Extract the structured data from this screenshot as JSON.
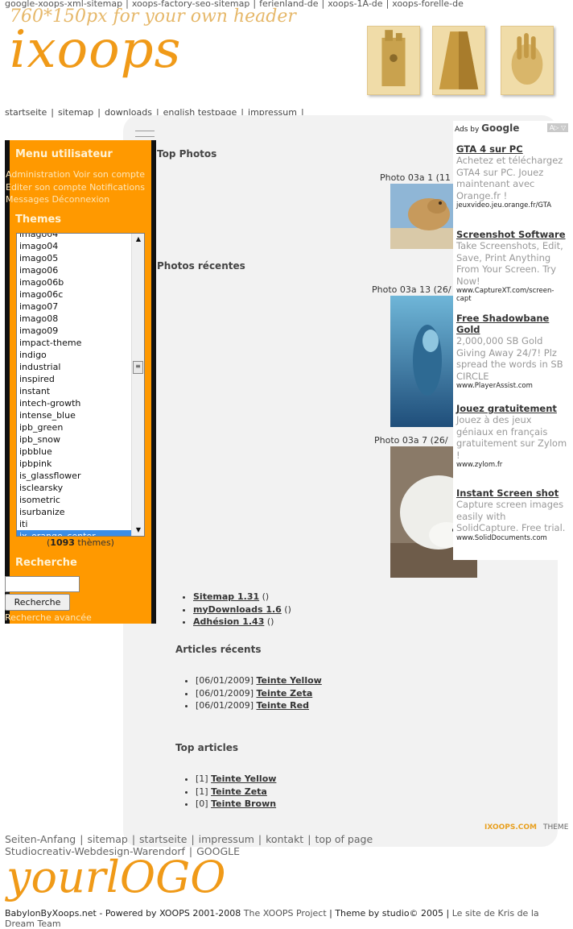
{
  "top_links": [
    "google-xoops-xml-sitemap",
    "xoops-factory-seo-sitemap",
    "ferienland-de",
    "xoops-1A-de",
    "xoops-forelle-de"
  ],
  "header": {
    "tagline": "760*150px for your own header",
    "logo_text": "ixoops"
  },
  "main_nav": [
    "startseite",
    "sitemap",
    "downloads",
    "english testpage",
    "impressum"
  ],
  "user_menu": {
    "title": "Menu utilisateur",
    "links": [
      "Administration",
      "Voir son compte",
      "Editer son compte",
      "Notifications",
      "Messages",
      "Déconnexion"
    ]
  },
  "themes": {
    "title": "Themes",
    "items": [
      "imago04",
      "imago05",
      "imago06",
      "imago06b",
      "imago06c",
      "imago07",
      "imago08",
      "imago09",
      "impact-theme",
      "indigo",
      "industrial",
      "inspired",
      "instant",
      "intech-growth",
      "intense_blue",
      "ipb_green",
      "ipb_snow",
      "ipbblue",
      "ipbpink",
      "is_glassflower",
      "isclearsky",
      "isometric",
      "isurbanize",
      "iti",
      "ix_orange_center"
    ],
    "selected": "ix_orange_center",
    "count_prefix": "(",
    "count": "1093",
    "count_suffix": " thèmes)"
  },
  "search": {
    "title": "Recherche",
    "input_value": "",
    "button_label": "Recherche",
    "advanced_link": "Recherche avancée"
  },
  "top_photos": {
    "title": "Top Photos",
    "caption": "Photo 03a 1 (11"
  },
  "recent_photos": {
    "title": "Photos récentes",
    "captions": [
      "Photo 03a 13 (26/",
      "Photo 03a 7 (26/"
    ]
  },
  "modules": [
    {
      "name": "Sitemap 1.31",
      "suffix": " ()"
    },
    {
      "name": "myDownloads 1.6",
      "suffix": " ()"
    },
    {
      "name": "Adhésion 1.43",
      "suffix": " ()"
    }
  ],
  "recent_articles": {
    "title": "Articles récents",
    "items": [
      {
        "prefix": "[06/01/2009] ",
        "link": "Teinte Yellow"
      },
      {
        "prefix": "[06/01/2009] ",
        "link": "Teinte Zeta"
      },
      {
        "prefix": "[06/01/2009] ",
        "link": "Teinte Red"
      }
    ]
  },
  "top_articles": {
    "title": "Top articles",
    "items": [
      {
        "prefix": "[1] ",
        "link": "Teinte Yellow"
      },
      {
        "prefix": "[1] ",
        "link": "Teinte Zeta"
      },
      {
        "prefix": "[0] ",
        "link": "Teinte Brown"
      }
    ]
  },
  "ads": {
    "header_prefix": "Ads by ",
    "header_brand": "Google",
    "chip": "A▷ ▽",
    "items": [
      {
        "title": "GTA 4 sur PC",
        "desc": "Achetez et téléchargez GTA4 sur PC. Jouez maintenant avec Orange.fr !",
        "url": "jeuxvideo.jeu.orange.fr/GTA"
      },
      {
        "title": "Screenshot Software",
        "desc": "Take Screenshots, Edit, Save, Print Anything From Your Screen. Try Now!",
        "url": "www.CaptureXT.com/screen-capt"
      },
      {
        "title": "Free Shadowbane Gold",
        "desc": "2,000,000 SB Gold Giving Away 24/7! Plz spread the words in SB CIRCLE",
        "url": "www.PlayerAssist.com"
      },
      {
        "title": "Jouez gratuitement",
        "desc": "Jouez à des jeux géniaux en français gratuitement sur Zylom !",
        "url": "www.zylom.fr"
      },
      {
        "title": "Instant Screen shot",
        "desc": "Capture screen images easily with SolidCapture. Free trial.",
        "url": "www.SolidDocuments.com"
      }
    ]
  },
  "theme_badge": {
    "left": "IXOOPS.COM",
    "right": "THEME"
  },
  "footer": {
    "links": [
      "Seiten-Anfang",
      "sitemap",
      "startseite",
      "impressum",
      "kontakt",
      "top of page",
      "Studiocreativ-Webdesign-Warendorf",
      "GOOGLE"
    ],
    "logo_text": "yourlOGO",
    "credits_1": "BabylonByXoops.net - Powered by XOOPS 2001-2008 ",
    "credits_link": "The XOOPS Project",
    "credits_2": " | Theme by studio© 2005 | ",
    "credits_link2": "Le site de Kris de la Dream Team"
  }
}
